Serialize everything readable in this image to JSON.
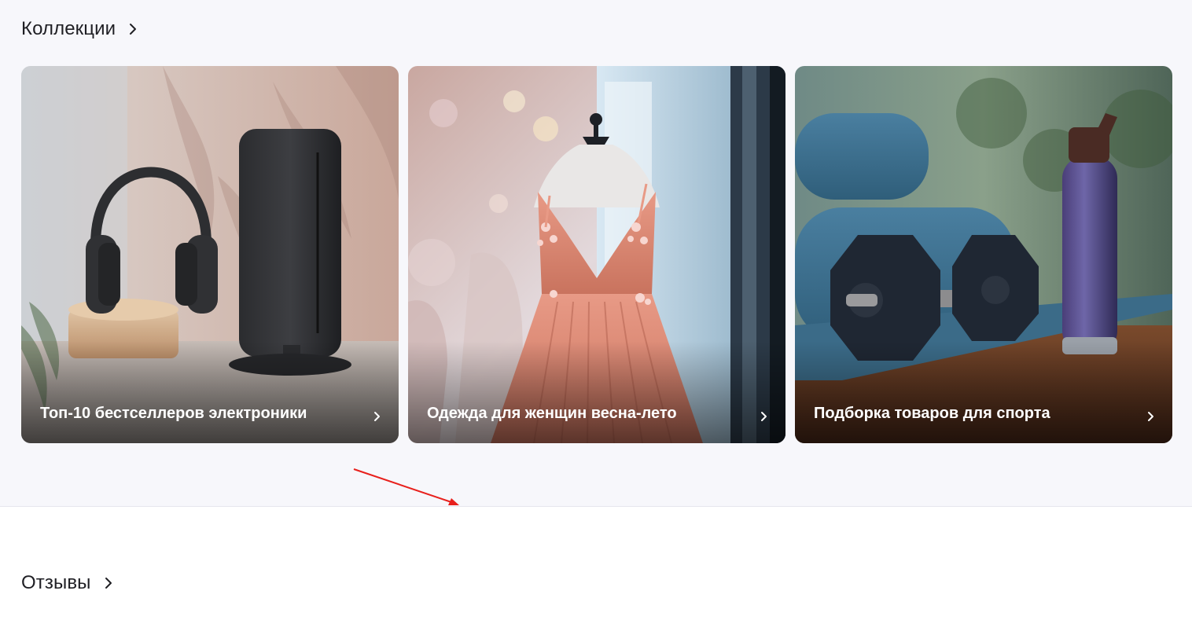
{
  "collections": {
    "title": "Коллекции",
    "items": [
      {
        "label": "Топ-10 бестселлеров электроники",
        "icon": "chevron-right-icon"
      },
      {
        "label": "Одежда для женщин весна-лето",
        "icon": "chevron-right-icon"
      },
      {
        "label": "Подборка товаров для спорта",
        "icon": "chevron-right-icon"
      }
    ]
  },
  "reviews": {
    "title": "Отзывы"
  },
  "colors": {
    "section_background": "#f7f7fb",
    "page_background": "#ffffff",
    "title_text": "#1f1f24",
    "caption_text": "#ffffff",
    "annotation_arrow": "#e8201c"
  }
}
